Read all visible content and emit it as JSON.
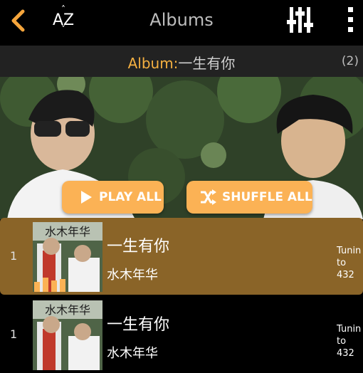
{
  "topbar": {
    "title": "Albums",
    "sort_label": "AZ",
    "icons": {
      "back": "chevron-left-icon",
      "sort": "sort-az-icon",
      "equalizer": "equalizer-icon",
      "more": "more-vertical-icon"
    }
  },
  "album": {
    "prefix": "Album:",
    "name": "一生有你",
    "count": "(2)"
  },
  "actions": {
    "play_all": "PLAY ALL",
    "shuffle_all": "SHUFFLE ALL"
  },
  "thumb_text": "水木年华",
  "tracks": [
    {
      "number": "1",
      "title": "一生有你",
      "artist": "水木年华",
      "tuning_line1": "Tunin",
      "tuning_line2": "to 432"
    },
    {
      "number": "1",
      "title": "一生有你",
      "artist": "水木年华",
      "tuning_line1": "Tunin",
      "tuning_line2": "to 432"
    }
  ],
  "colors": {
    "accent": "#fbb255",
    "album_key": "#f5b041",
    "active_row": "#8a6428",
    "album_bar": "#222222"
  }
}
